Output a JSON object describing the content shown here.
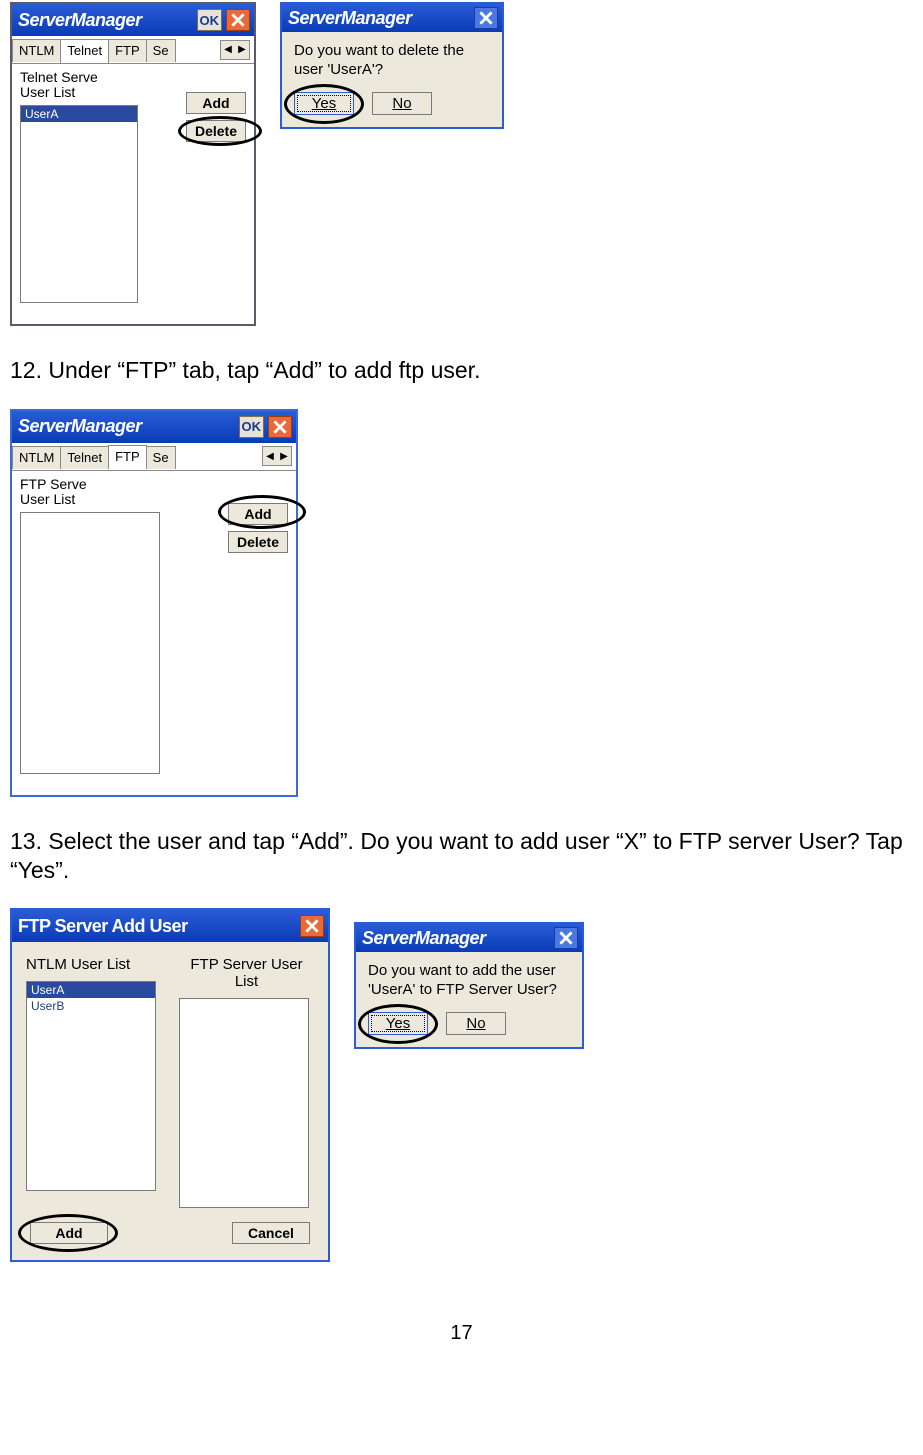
{
  "fig1a": {
    "title": "ServerManager",
    "ok": "OK",
    "tabs": [
      "NTLM",
      "Telnet",
      "FTP",
      "Se"
    ],
    "active_tab": "Telnet",
    "label_line1": "Telnet Serve",
    "label_line2": "User List",
    "items": [
      "UserA"
    ],
    "add_label": "Add",
    "delete_label": "Delete"
  },
  "fig1b": {
    "title": "ServerManager",
    "msg": "Do you want to delete the user 'UserA'?",
    "yes": "Yes",
    "no": "No"
  },
  "step12": "12. Under “FTP” tab, tap “Add” to add ftp user.",
  "fig2": {
    "title": "ServerManager",
    "ok": "OK",
    "tabs": [
      "NTLM",
      "Telnet",
      "FTP",
      "Se"
    ],
    "active_tab": "FTP",
    "label_line1": "FTP Serve",
    "label_line2": "User List",
    "add_label": "Add",
    "delete_label": "Delete"
  },
  "step13": "13. Select the user and tap “Add”. Do you want to add user “X” to FTP server User? Tap “Yes”.",
  "fig3a": {
    "title": "FTP Server Add User",
    "left_label": "NTLM User List",
    "right_label": "FTP Server User List",
    "left_items": [
      "UserA",
      "UserB"
    ],
    "add_label": "Add",
    "cancel_label": "Cancel"
  },
  "fig3b": {
    "title": "ServerManager",
    "msg": "Do you want to add the user 'UserA' to FTP Server User?",
    "yes": "Yes",
    "no": "No"
  },
  "page_number": "17"
}
